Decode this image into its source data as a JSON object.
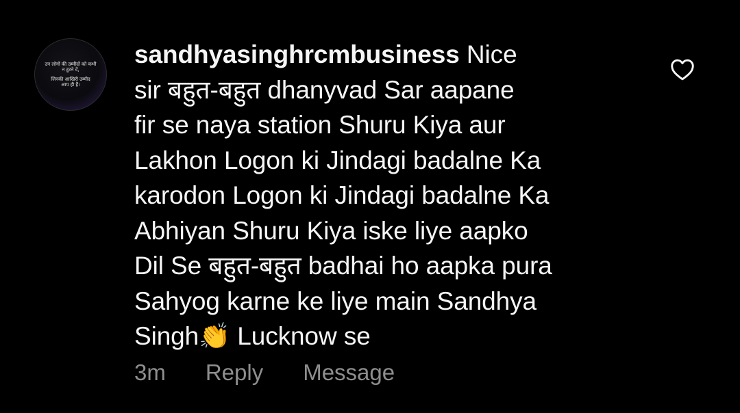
{
  "comment": {
    "avatar_text": [
      "उन लोगों की उम्मीदों को कभी",
      "न टूटने दें,",
      "जिनकी आखिरी उम्मीद",
      "आप ही हैं।"
    ],
    "username": "sandhyasinghrcmbusiness",
    "lines": [
      " Nice",
      "sir बहुत-बहुत dhanyvad Sar aapane",
      "fir se naya station Shuru Kiya aur",
      "Lakhon Logon ki Jindagi badalne Ka",
      "karodon Logon ki Jindagi badalne Ka",
      "Abhiyan Shuru Kiya iske liye aapko",
      "Dil Se बहुत-बहुत badhai ho aapka pura",
      "Sahyog karne ke liye main Sandhya",
      "Singh"
    ],
    "emoji": "👏",
    "last_line_tail": " Lucknow se",
    "time_ago": "3m",
    "reply_label": "Reply",
    "message_label": "Message",
    "like_icon": "heart-outline-icon",
    "colors": {
      "background": "#000000",
      "text": "#f5f5f5",
      "meta": "#8e8e8e"
    }
  }
}
